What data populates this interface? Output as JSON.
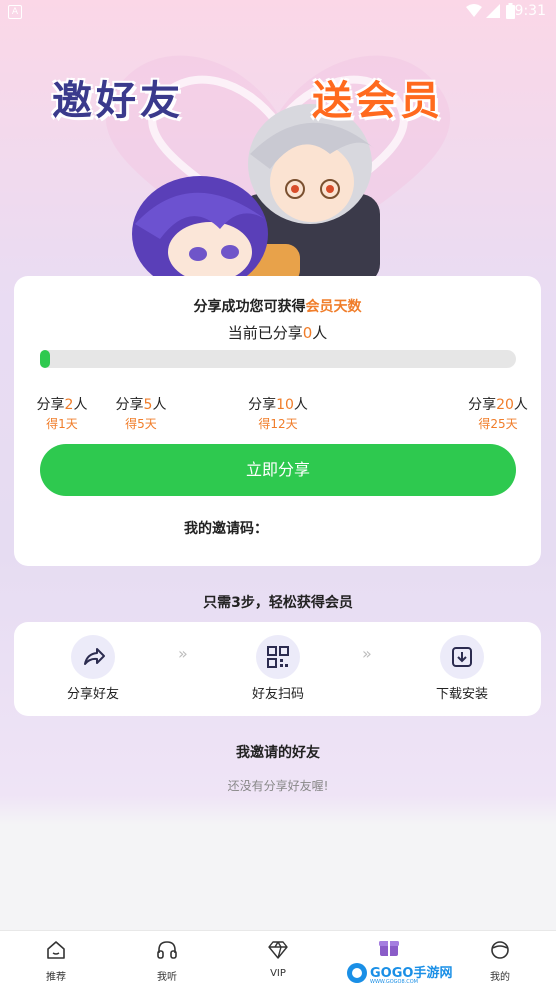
{
  "status_bar": {
    "time": "9:31",
    "badge": "A"
  },
  "hero": {
    "title_left": "邀好友",
    "title_right": "送会员"
  },
  "card": {
    "headline_prefix": "分享成功您可获得",
    "headline_highlight": "会员天数",
    "shared_prefix": "当前已分享",
    "shared_count": "0",
    "shared_suffix": "人",
    "progress": 0.02,
    "milestones": [
      {
        "label_prefix": "分享",
        "count": "2",
        "label_suffix": "人",
        "reward": "得1天"
      },
      {
        "label_prefix": "分享",
        "count": "5",
        "label_suffix": "人",
        "reward": "得5天"
      },
      {
        "label_prefix": "分享",
        "count": "10",
        "label_suffix": "人",
        "reward": "得12天"
      },
      {
        "label_prefix": "分享",
        "count": "20",
        "label_suffix": "人",
        "reward": "得25天"
      }
    ],
    "share_button": "立即分享",
    "invite_code_label": "我的邀请码："
  },
  "steps": {
    "title": "只需3步，轻松获得会员",
    "items": [
      {
        "label": "分享好友",
        "icon": "share-arrow-icon"
      },
      {
        "label": "好友扫码",
        "icon": "qr-code-icon"
      },
      {
        "label": "下载安装",
        "icon": "download-icon"
      }
    ],
    "separator": "»"
  },
  "friends": {
    "title": "我邀请的好友",
    "empty_text": "还没有分享好友喔!"
  },
  "nav": {
    "items": [
      {
        "label": "推荐",
        "icon": "home-icon"
      },
      {
        "label": "我听",
        "icon": "headphones-icon"
      },
      {
        "label": "VIP",
        "icon": "diamond-icon"
      },
      {
        "label": "",
        "icon": "gift-icon"
      },
      {
        "label": "我的",
        "icon": "profile-icon"
      }
    ]
  },
  "watermark": {
    "text": "GOGO手游网",
    "sub": "WWW.GOGO8.COM"
  },
  "colors": {
    "accent_green": "#2ec94f",
    "accent_orange": "#f07d2a",
    "navy": "#3a3a8c"
  }
}
